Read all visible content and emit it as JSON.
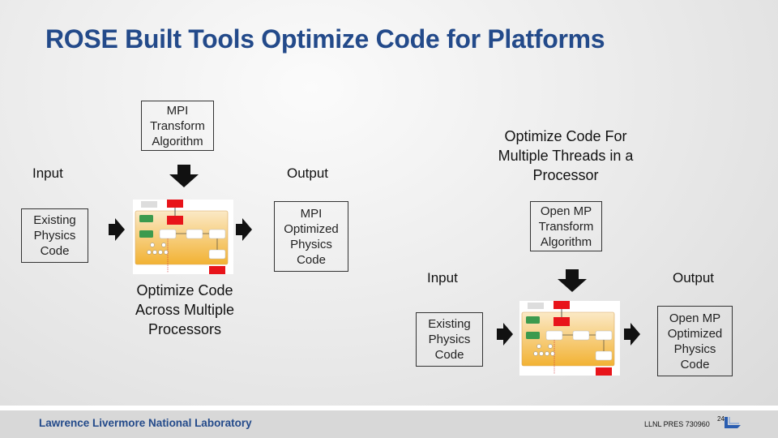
{
  "slide": {
    "title": "ROSE Built Tools Optimize Code for Platforms",
    "mpi_section": {
      "transform_box": [
        "MPI",
        "Transform",
        "Algorithm"
      ],
      "input_label": "Input",
      "output_label": "Output",
      "input_box": [
        "Existing",
        "Physics",
        "Code"
      ],
      "output_box": [
        "MPI",
        "Optimized",
        "Physics",
        "Code"
      ],
      "caption": [
        "Optimize Code",
        "Across Multiple",
        "Processors"
      ]
    },
    "openmp_section": {
      "heading": [
        "Optimize Code For",
        "Multiple Threads in a",
        "Processor"
      ],
      "transform_box": [
        "Open MP",
        "Transform",
        "Algorithm"
      ],
      "input_label": "Input",
      "output_label": "Output",
      "input_box": [
        "Existing",
        "Physics",
        "Code"
      ],
      "output_box": [
        "Open MP",
        "Optimized",
        "Physics",
        "Code"
      ]
    },
    "colors": {
      "title": "#234a8a",
      "flow_red": "#e8141a",
      "flow_green": "#3c9a4e",
      "flow_orange": "#f2b233"
    }
  },
  "footer": {
    "organization": "Lawrence Livermore National Laboratory",
    "doc_id": "LLNL PRES 730960",
    "page_number": "24",
    "logo": "llnl-logo-icon"
  }
}
